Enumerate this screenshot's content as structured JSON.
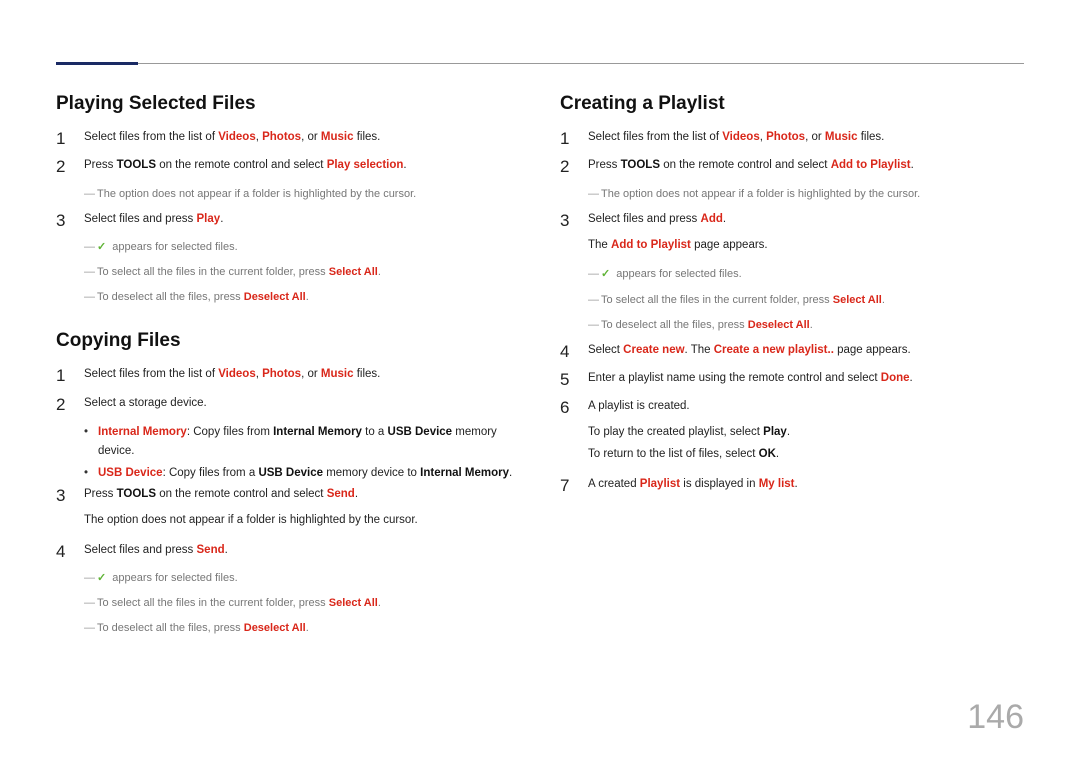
{
  "page_number": "146",
  "left": {
    "h1": "Playing Selected Files",
    "s1_a": "Select files from the list of ",
    "videos": "Videos",
    "photos": "Photos",
    "music": "Music",
    "s1_b": " files.",
    "s2_a": "Press ",
    "tools": "TOOLS",
    "s2_b": " on the remote control and select ",
    "play_selection": "Play selection",
    "n1": "The option does not appear if a folder is highlighted by the cursor.",
    "s3_a": "Select files and press ",
    "play": "Play",
    "n2": " appears for selected files.",
    "n3_a": "To select all the files in the current folder, press ",
    "select_all": "Select All",
    "n4_a": "To deselect all the files, press ",
    "deselect_all": "Deselect All",
    "h2": "Copying Files",
    "c1_a": "Select files from the list of ",
    "c2": "Select a storage device.",
    "b1_a": "Internal Memory",
    "b1_b": ": Copy files from ",
    "b1_c": "Internal Memory",
    "b1_d": " to a ",
    "b1_e": "USB Device",
    "b1_f": " memory device.",
    "b2_a": "USB Device",
    "b2_b": ": Copy files from a ",
    "b2_c": "USB Device",
    "b2_d": " memory device to ",
    "b2_e": "Internal Memory",
    "c3_a": "Press ",
    "c3_b": " on the remote control and select ",
    "send": "Send",
    "c3_note": "The option does not appear if a folder is highlighted by the cursor.",
    "c4_a": "Select files and press "
  },
  "right": {
    "h1": "Creating a Playlist",
    "s1_a": "Select files from the list of ",
    "videos": "Videos",
    "photos": "Photos",
    "music": "Music",
    "s1_b": " files.",
    "s2_a": "Press ",
    "tools": "TOOLS",
    "s2_b": " on the remote control and select ",
    "add_to_playlist": "Add to Playlist",
    "n1": "The option does not appear if a folder is highlighted by the cursor.",
    "s3_a": "Select files and press ",
    "add": "Add",
    "s3_sub_a": "The ",
    "s3_sub_b": " page appears.",
    "n2": " appears for selected files.",
    "n3_a": "To select all the files in the current folder, press ",
    "select_all": "Select All",
    "n4_a": "To deselect all the files, press ",
    "deselect_all": "Deselect All",
    "s4_a": "Select ",
    "create_new": "Create new",
    "s4_b": ". The ",
    "create_new_playlist": "Create a new playlist..",
    "s4_c": " page appears.",
    "s5_a": "Enter a playlist name using the remote control and select ",
    "done": "Done",
    "s6": "A playlist is created.",
    "s6_sub1_a": "To play the created playlist, select ",
    "play": "Play",
    "s6_sub2_a": "To return to the list of files, select ",
    "ok": "OK",
    "s7_a": "A created ",
    "playlist": "Playlist",
    "s7_b": " is displayed in ",
    "my_list": "My list"
  }
}
